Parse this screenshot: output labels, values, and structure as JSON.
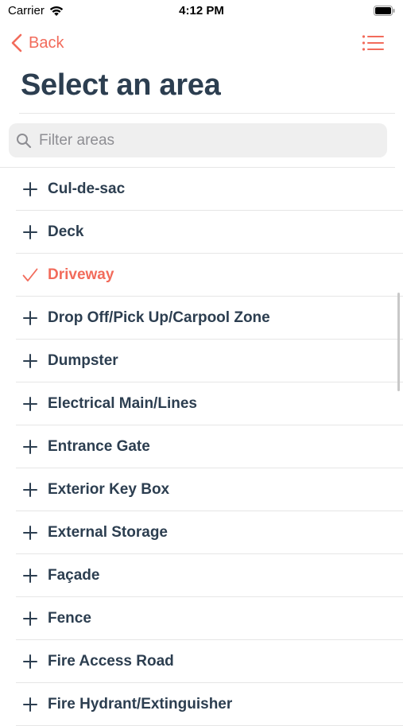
{
  "status_bar": {
    "carrier": "Carrier",
    "time": "4:12 PM"
  },
  "nav": {
    "back_label": "Back",
    "menu_icon": "list-icon"
  },
  "page": {
    "title": "Select an area"
  },
  "search": {
    "placeholder": "Filter areas",
    "value": ""
  },
  "colors": {
    "accent": "#f26b5b",
    "text": "#2c3e50",
    "separator": "#e6e6e6",
    "search_bg": "#efefef"
  },
  "areas": [
    {
      "label": "Cul-de-sac",
      "selected": false
    },
    {
      "label": "Deck",
      "selected": false
    },
    {
      "label": "Driveway",
      "selected": true
    },
    {
      "label": "Drop Off/Pick Up/Carpool Zone",
      "selected": false
    },
    {
      "label": "Dumpster",
      "selected": false
    },
    {
      "label": "Electrical Main/Lines",
      "selected": false
    },
    {
      "label": "Entrance Gate",
      "selected": false
    },
    {
      "label": "Exterior Key Box",
      "selected": false
    },
    {
      "label": "External Storage",
      "selected": false
    },
    {
      "label": "Façade",
      "selected": false
    },
    {
      "label": "Fence",
      "selected": false
    },
    {
      "label": "Fire Access Road",
      "selected": false
    },
    {
      "label": "Fire Hydrant/Extinguisher",
      "selected": false
    }
  ]
}
